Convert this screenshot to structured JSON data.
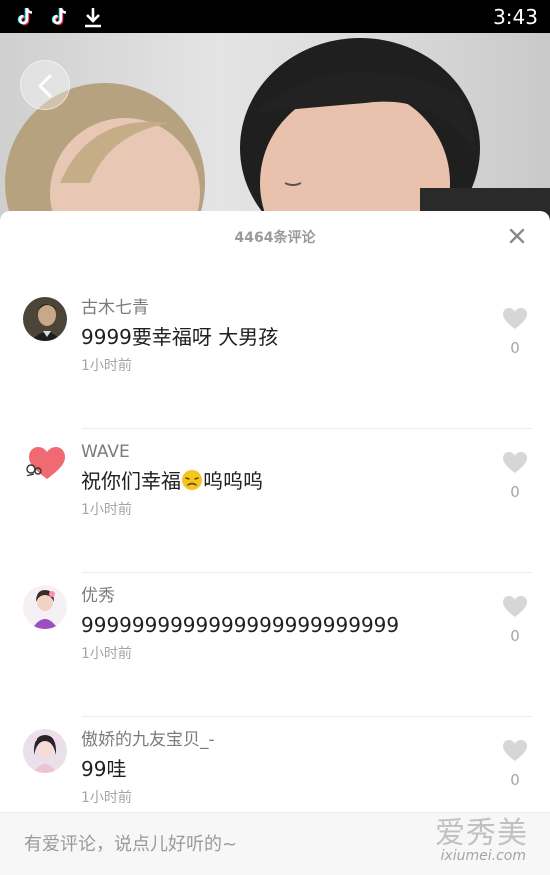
{
  "status_bar": {
    "time": "3:43",
    "icons": [
      "tiktok-icon",
      "tiktok-icon",
      "download-icon"
    ]
  },
  "video": {
    "back_icon": "back-chevron-icon"
  },
  "comments_panel": {
    "count_label": "4464条评论",
    "close_icon": "close-icon",
    "comments": [
      {
        "username": "古木七青",
        "text": "9999要幸福呀  大男孩",
        "time": "1小时前",
        "likes": "0"
      },
      {
        "username": "WAVE",
        "text_before": "祝你们幸福",
        "emoji": "sad-face-emoji",
        "text_after": "呜呜呜",
        "time": "1小时前",
        "likes": "0"
      },
      {
        "username": "优秀",
        "text": "9999999999999999999999999",
        "time": "1小时前",
        "likes": "0"
      },
      {
        "username": "傲娇的九友宝贝_-",
        "text": "99哇",
        "time": "1小时前",
        "likes": "0"
      }
    ]
  },
  "input": {
    "placeholder": "有爱评论，说点儿好听的~"
  },
  "watermark": {
    "logo": "爱秀美",
    "url": "ixiumei.com"
  },
  "colors": {
    "status_bar_bg": "#000000",
    "heart_gray": "#d6d6d6",
    "muted_text": "#9a9a9a"
  }
}
